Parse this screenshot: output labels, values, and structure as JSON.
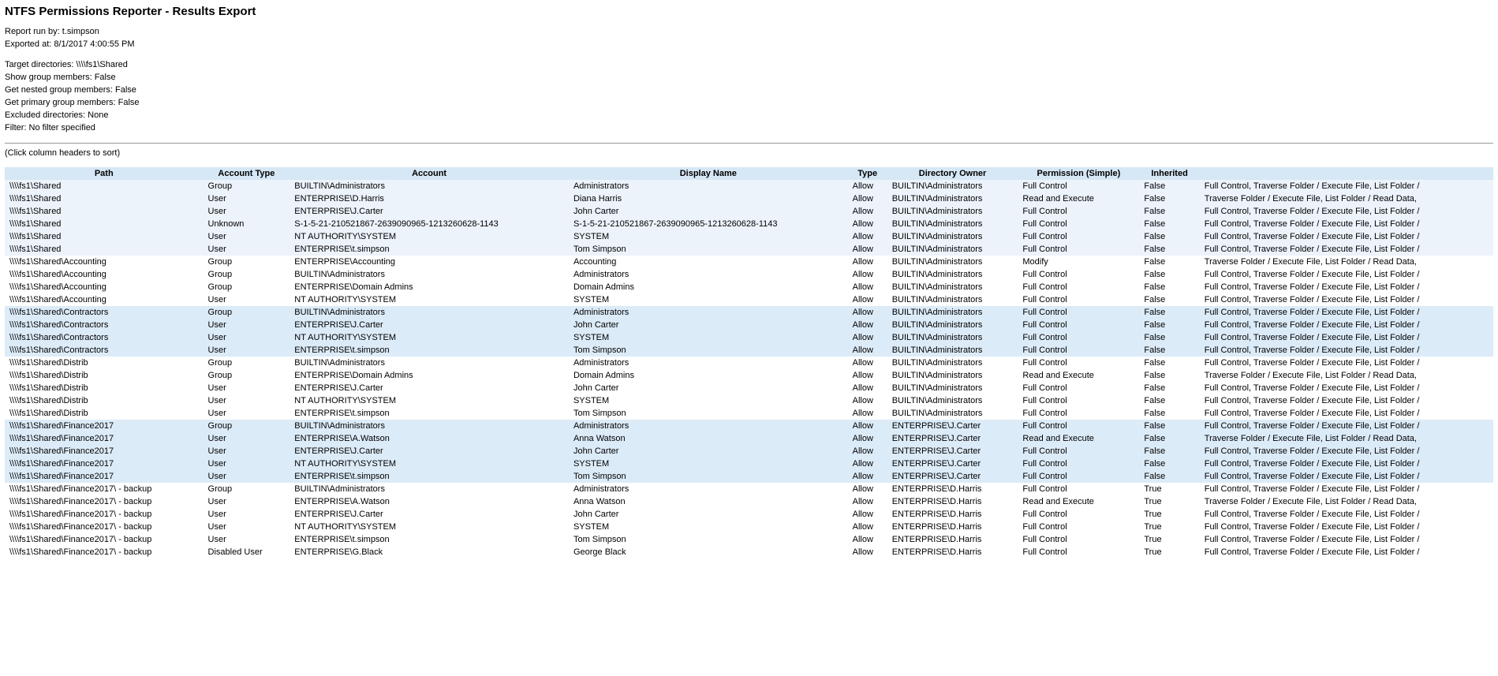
{
  "title": "NTFS Permissions Reporter - Results Export",
  "meta": {
    "report_run_by_label": "Report run by: t.simpson",
    "exported_at_label": "Exported at: 8/1/2017 4:00:55 PM",
    "target_dirs_label": "Target directories: \\\\\\\\fs1\\Shared",
    "show_group_members_label": "Show group members: False",
    "get_nested_label": "Get nested group members: False",
    "get_primary_label": "Get primary group members: False",
    "excluded_dirs_label": "Excluded directories: None",
    "filter_label": "Filter: No filter specified"
  },
  "hint": "(Click column headers to sort)",
  "columns": [
    "Path",
    "Account Type",
    "Account",
    "Display Name",
    "Type",
    "Directory Owner",
    "Permission (Simple)",
    "Inherited",
    ""
  ],
  "rows": [
    {
      "g": 0,
      "path": "\\\\\\\\fs1\\Shared",
      "acct_type": "Group",
      "account": "BUILTIN\\Administrators",
      "display": "Administrators",
      "type": "Allow",
      "owner": "BUILTIN\\Administrators",
      "perm": "Full Control",
      "inherited": "False",
      "perm_detail": "Full Control, Traverse Folder / Execute File, List Folder /"
    },
    {
      "g": 0,
      "path": "\\\\\\\\fs1\\Shared",
      "acct_type": "User",
      "account": "ENTERPRISE\\D.Harris",
      "display": "Diana Harris",
      "type": "Allow",
      "owner": "BUILTIN\\Administrators",
      "perm": "Read and Execute",
      "inherited": "False",
      "perm_detail": "Traverse Folder / Execute File, List Folder / Read Data,"
    },
    {
      "g": 0,
      "path": "\\\\\\\\fs1\\Shared",
      "acct_type": "User",
      "account": "ENTERPRISE\\J.Carter",
      "display": "John Carter",
      "type": "Allow",
      "owner": "BUILTIN\\Administrators",
      "perm": "Full Control",
      "inherited": "False",
      "perm_detail": "Full Control, Traverse Folder / Execute File, List Folder /"
    },
    {
      "g": 0,
      "path": "\\\\\\\\fs1\\Shared",
      "acct_type": "Unknown",
      "account": "S-1-5-21-210521867-2639090965-1213260628-1143",
      "display": "S-1-5-21-210521867-2639090965-1213260628-1143",
      "type": "Allow",
      "owner": "BUILTIN\\Administrators",
      "perm": "Full Control",
      "inherited": "False",
      "perm_detail": "Full Control, Traverse Folder / Execute File, List Folder /"
    },
    {
      "g": 0,
      "path": "\\\\\\\\fs1\\Shared",
      "acct_type": "User",
      "account": "NT AUTHORITY\\SYSTEM",
      "display": "SYSTEM",
      "type": "Allow",
      "owner": "BUILTIN\\Administrators",
      "perm": "Full Control",
      "inherited": "False",
      "perm_detail": "Full Control, Traverse Folder / Execute File, List Folder /"
    },
    {
      "g": 0,
      "path": "\\\\\\\\fs1\\Shared",
      "acct_type": "User",
      "account": "ENTERPRISE\\t.simpson",
      "display": "Tom Simpson",
      "type": "Allow",
      "owner": "BUILTIN\\Administrators",
      "perm": "Full Control",
      "inherited": "False",
      "perm_detail": "Full Control, Traverse Folder / Execute File, List Folder /"
    },
    {
      "g": 1,
      "path": "\\\\\\\\fs1\\Shared\\Accounting",
      "acct_type": "Group",
      "account": "ENTERPRISE\\Accounting",
      "display": "Accounting",
      "type": "Allow",
      "owner": "BUILTIN\\Administrators",
      "perm": "Modify",
      "inherited": "False",
      "perm_detail": "Traverse Folder / Execute File, List Folder / Read Data,"
    },
    {
      "g": 1,
      "path": "\\\\\\\\fs1\\Shared\\Accounting",
      "acct_type": "Group",
      "account": "BUILTIN\\Administrators",
      "display": "Administrators",
      "type": "Allow",
      "owner": "BUILTIN\\Administrators",
      "perm": "Full Control",
      "inherited": "False",
      "perm_detail": "Full Control, Traverse Folder / Execute File, List Folder /"
    },
    {
      "g": 1,
      "path": "\\\\\\\\fs1\\Shared\\Accounting",
      "acct_type": "Group",
      "account": "ENTERPRISE\\Domain Admins",
      "display": "Domain Admins",
      "type": "Allow",
      "owner": "BUILTIN\\Administrators",
      "perm": "Full Control",
      "inherited": "False",
      "perm_detail": "Full Control, Traverse Folder / Execute File, List Folder /"
    },
    {
      "g": 1,
      "path": "\\\\\\\\fs1\\Shared\\Accounting",
      "acct_type": "User",
      "account": "NT AUTHORITY\\SYSTEM",
      "display": "SYSTEM",
      "type": "Allow",
      "owner": "BUILTIN\\Administrators",
      "perm": "Full Control",
      "inherited": "False",
      "perm_detail": "Full Control, Traverse Folder / Execute File, List Folder /"
    },
    {
      "g": 2,
      "path": "\\\\\\\\fs1\\Shared\\Contractors",
      "acct_type": "Group",
      "account": "BUILTIN\\Administrators",
      "display": "Administrators",
      "type": "Allow",
      "owner": "BUILTIN\\Administrators",
      "perm": "Full Control",
      "inherited": "False",
      "perm_detail": "Full Control, Traverse Folder / Execute File, List Folder /"
    },
    {
      "g": 2,
      "path": "\\\\\\\\fs1\\Shared\\Contractors",
      "acct_type": "User",
      "account": "ENTERPRISE\\J.Carter",
      "display": "John Carter",
      "type": "Allow",
      "owner": "BUILTIN\\Administrators",
      "perm": "Full Control",
      "inherited": "False",
      "perm_detail": "Full Control, Traverse Folder / Execute File, List Folder /"
    },
    {
      "g": 2,
      "path": "\\\\\\\\fs1\\Shared\\Contractors",
      "acct_type": "User",
      "account": "NT AUTHORITY\\SYSTEM",
      "display": "SYSTEM",
      "type": "Allow",
      "owner": "BUILTIN\\Administrators",
      "perm": "Full Control",
      "inherited": "False",
      "perm_detail": "Full Control, Traverse Folder / Execute File, List Folder /"
    },
    {
      "g": 2,
      "path": "\\\\\\\\fs1\\Shared\\Contractors",
      "acct_type": "User",
      "account": "ENTERPRISE\\t.simpson",
      "display": "Tom Simpson",
      "type": "Allow",
      "owner": "BUILTIN\\Administrators",
      "perm": "Full Control",
      "inherited": "False",
      "perm_detail": "Full Control, Traverse Folder / Execute File, List Folder /"
    },
    {
      "g": 1,
      "path": "\\\\\\\\fs1\\Shared\\Distrib",
      "acct_type": "Group",
      "account": "BUILTIN\\Administrators",
      "display": "Administrators",
      "type": "Allow",
      "owner": "BUILTIN\\Administrators",
      "perm": "Full Control",
      "inherited": "False",
      "perm_detail": "Full Control, Traverse Folder / Execute File, List Folder /"
    },
    {
      "g": 1,
      "path": "\\\\\\\\fs1\\Shared\\Distrib",
      "acct_type": "Group",
      "account": "ENTERPRISE\\Domain Admins",
      "display": "Domain Admins",
      "type": "Allow",
      "owner": "BUILTIN\\Administrators",
      "perm": "Read and Execute",
      "inherited": "False",
      "perm_detail": "Traverse Folder / Execute File, List Folder / Read Data,"
    },
    {
      "g": 1,
      "path": "\\\\\\\\fs1\\Shared\\Distrib",
      "acct_type": "User",
      "account": "ENTERPRISE\\J.Carter",
      "display": "John Carter",
      "type": "Allow",
      "owner": "BUILTIN\\Administrators",
      "perm": "Full Control",
      "inherited": "False",
      "perm_detail": "Full Control, Traverse Folder / Execute File, List Folder /"
    },
    {
      "g": 1,
      "path": "\\\\\\\\fs1\\Shared\\Distrib",
      "acct_type": "User",
      "account": "NT AUTHORITY\\SYSTEM",
      "display": "SYSTEM",
      "type": "Allow",
      "owner": "BUILTIN\\Administrators",
      "perm": "Full Control",
      "inherited": "False",
      "perm_detail": "Full Control, Traverse Folder / Execute File, List Folder /"
    },
    {
      "g": 1,
      "path": "\\\\\\\\fs1\\Shared\\Distrib",
      "acct_type": "User",
      "account": "ENTERPRISE\\t.simpson",
      "display": "Tom Simpson",
      "type": "Allow",
      "owner": "BUILTIN\\Administrators",
      "perm": "Full Control",
      "inherited": "False",
      "perm_detail": "Full Control, Traverse Folder / Execute File, List Folder /"
    },
    {
      "g": 2,
      "path": "\\\\\\\\fs1\\Shared\\Finance2017",
      "acct_type": "Group",
      "account": "BUILTIN\\Administrators",
      "display": "Administrators",
      "type": "Allow",
      "owner": "ENTERPRISE\\J.Carter",
      "perm": "Full Control",
      "inherited": "False",
      "perm_detail": "Full Control, Traverse Folder / Execute File, List Folder /"
    },
    {
      "g": 2,
      "path": "\\\\\\\\fs1\\Shared\\Finance2017",
      "acct_type": "User",
      "account": "ENTERPRISE\\A.Watson",
      "display": "Anna Watson",
      "type": "Allow",
      "owner": "ENTERPRISE\\J.Carter",
      "perm": "Read and Execute",
      "inherited": "False",
      "perm_detail": "Traverse Folder / Execute File, List Folder / Read Data,"
    },
    {
      "g": 2,
      "path": "\\\\\\\\fs1\\Shared\\Finance2017",
      "acct_type": "User",
      "account": "ENTERPRISE\\J.Carter",
      "display": "John Carter",
      "type": "Allow",
      "owner": "ENTERPRISE\\J.Carter",
      "perm": "Full Control",
      "inherited": "False",
      "perm_detail": "Full Control, Traverse Folder / Execute File, List Folder /"
    },
    {
      "g": 2,
      "path": "\\\\\\\\fs1\\Shared\\Finance2017",
      "acct_type": "User",
      "account": "NT AUTHORITY\\SYSTEM",
      "display": "SYSTEM",
      "type": "Allow",
      "owner": "ENTERPRISE\\J.Carter",
      "perm": "Full Control",
      "inherited": "False",
      "perm_detail": "Full Control, Traverse Folder / Execute File, List Folder /"
    },
    {
      "g": 2,
      "path": "\\\\\\\\fs1\\Shared\\Finance2017",
      "acct_type": "User",
      "account": "ENTERPRISE\\t.simpson",
      "display": "Tom Simpson",
      "type": "Allow",
      "owner": "ENTERPRISE\\J.Carter",
      "perm": "Full Control",
      "inherited": "False",
      "perm_detail": "Full Control, Traverse Folder / Execute File, List Folder /"
    },
    {
      "g": 1,
      "path": "\\\\\\\\fs1\\Shared\\Finance2017\\ - backup",
      "acct_type": "Group",
      "account": "BUILTIN\\Administrators",
      "display": "Administrators",
      "type": "Allow",
      "owner": "ENTERPRISE\\D.Harris",
      "perm": "Full Control",
      "inherited": "True",
      "perm_detail": "Full Control, Traverse Folder / Execute File, List Folder /"
    },
    {
      "g": 1,
      "path": "\\\\\\\\fs1\\Shared\\Finance2017\\ - backup",
      "acct_type": "User",
      "account": "ENTERPRISE\\A.Watson",
      "display": "Anna Watson",
      "type": "Allow",
      "owner": "ENTERPRISE\\D.Harris",
      "perm": "Read and Execute",
      "inherited": "True",
      "perm_detail": "Traverse Folder / Execute File, List Folder / Read Data,"
    },
    {
      "g": 1,
      "path": "\\\\\\\\fs1\\Shared\\Finance2017\\ - backup",
      "acct_type": "User",
      "account": "ENTERPRISE\\J.Carter",
      "display": "John Carter",
      "type": "Allow",
      "owner": "ENTERPRISE\\D.Harris",
      "perm": "Full Control",
      "inherited": "True",
      "perm_detail": "Full Control, Traverse Folder / Execute File, List Folder /"
    },
    {
      "g": 1,
      "path": "\\\\\\\\fs1\\Shared\\Finance2017\\ - backup",
      "acct_type": "User",
      "account": "NT AUTHORITY\\SYSTEM",
      "display": "SYSTEM",
      "type": "Allow",
      "owner": "ENTERPRISE\\D.Harris",
      "perm": "Full Control",
      "inherited": "True",
      "perm_detail": "Full Control, Traverse Folder / Execute File, List Folder /"
    },
    {
      "g": 1,
      "path": "\\\\\\\\fs1\\Shared\\Finance2017\\ - backup",
      "acct_type": "User",
      "account": "ENTERPRISE\\t.simpson",
      "display": "Tom Simpson",
      "type": "Allow",
      "owner": "ENTERPRISE\\D.Harris",
      "perm": "Full Control",
      "inherited": "True",
      "perm_detail": "Full Control, Traverse Folder / Execute File, List Folder /"
    },
    {
      "g": 1,
      "path": "\\\\\\\\fs1\\Shared\\Finance2017\\ - backup",
      "acct_type": "Disabled User",
      "account": "ENTERPRISE\\G.Black",
      "display": "George Black",
      "type": "Allow",
      "owner": "ENTERPRISE\\D.Harris",
      "perm": "Full Control",
      "inherited": "True",
      "perm_detail": "Full Control, Traverse Folder / Execute File, List Folder /"
    }
  ]
}
